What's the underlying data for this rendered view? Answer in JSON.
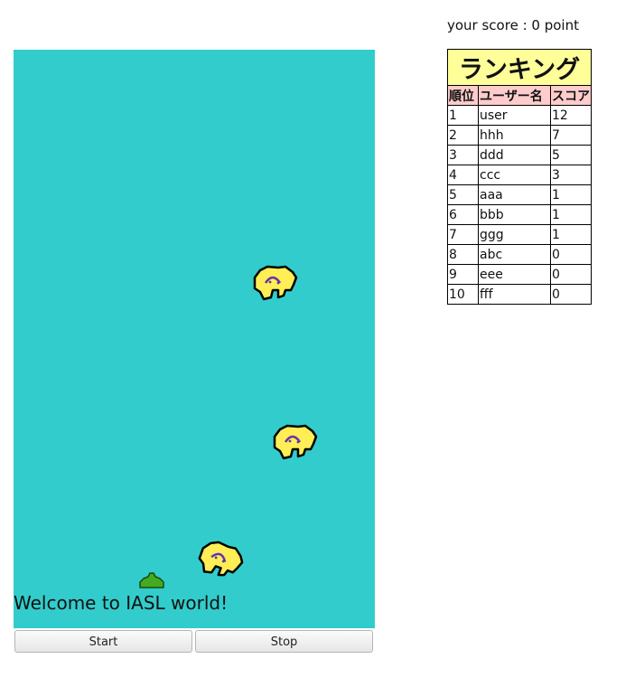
{
  "score_text": "your score : 0 point",
  "game": {
    "welcome": "Welcome to IASL world!",
    "background_color": "#33cccc",
    "enemy_color": "#ffee55",
    "player_color": "#44aa22"
  },
  "controls": {
    "start_label": "Start",
    "stop_label": "Stop"
  },
  "ranking": {
    "title": "ランキング",
    "headers": [
      "順位",
      "ユーザー名",
      "スコア"
    ],
    "rows": [
      [
        "1",
        "user",
        "12"
      ],
      [
        "2",
        "hhh",
        "7"
      ],
      [
        "3",
        "ddd",
        "5"
      ],
      [
        "4",
        "ccc",
        "3"
      ],
      [
        "5",
        "aaa",
        "1"
      ],
      [
        "6",
        "bbb",
        "1"
      ],
      [
        "7",
        "ggg",
        "1"
      ],
      [
        "8",
        "abc",
        "0"
      ],
      [
        "9",
        "eee",
        "0"
      ],
      [
        "10",
        "fff",
        "0"
      ]
    ],
    "title_bg": "#ffff99",
    "header_bg": "#ffcccc"
  }
}
